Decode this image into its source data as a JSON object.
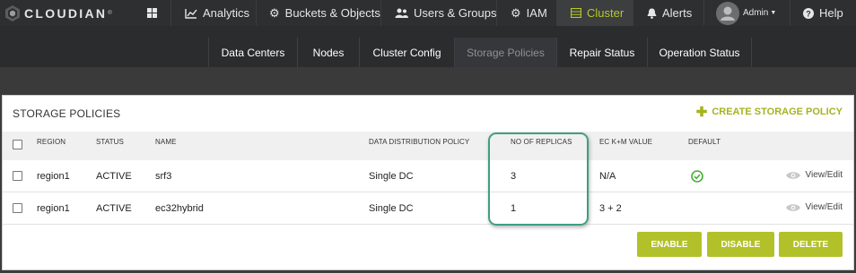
{
  "brand": {
    "name": "CLOUDIAN",
    "tm": "®"
  },
  "nav": {
    "dashboard_icon": "grid-icon",
    "analytics": "Analytics",
    "buckets": "Buckets & Objects",
    "users": "Users & Groups",
    "iam": "IAM",
    "cluster": "Cluster",
    "alerts": "Alerts",
    "admin": "Admin",
    "help": "Help"
  },
  "subnav": [
    "Data Centers",
    "Nodes",
    "Cluster Config",
    "Storage Policies",
    "Repair Status",
    "Operation Status"
  ],
  "panel": {
    "title": "STORAGE POLICIES",
    "create_label": "CREATE STORAGE POLICY"
  },
  "table": {
    "headers": {
      "region": "REGION",
      "status": "STATUS",
      "name": "NAME",
      "distribution": "DATA DISTRIBUTION POLICY",
      "replicas": "NO OF REPLICAS",
      "ec": "EC K+M VALUE",
      "default": "DEFAULT"
    },
    "rows": [
      {
        "region": "region1",
        "status": "ACTIVE",
        "name": "srf3",
        "distribution": "Single DC",
        "replicas": "3",
        "ec": "N/A",
        "default": true,
        "action": "View/Edit"
      },
      {
        "region": "region1",
        "status": "ACTIVE",
        "name": "ec32hybrid",
        "distribution": "Single DC",
        "replicas": "1",
        "ec": "3 + 2",
        "default": false,
        "action": "View/Edit"
      }
    ]
  },
  "buttons": {
    "enable": "ENABLE",
    "disable": "DISABLE",
    "delete": "DELETE"
  },
  "colors": {
    "accent": "#b2c12a",
    "highlight": "#3f9f83",
    "topbar": "#2d2f31"
  }
}
